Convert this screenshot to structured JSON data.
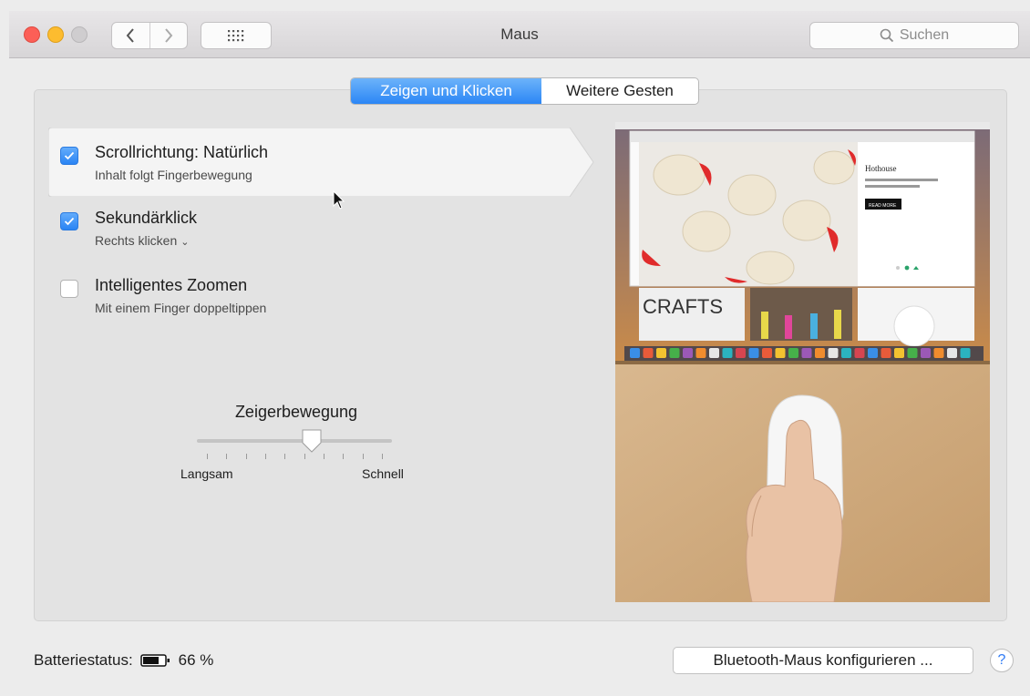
{
  "window": {
    "title": "Maus",
    "search_placeholder": "Suchen"
  },
  "tabs": [
    {
      "label": "Zeigen und Klicken",
      "active": true
    },
    {
      "label": "Weitere Gesten",
      "active": false
    }
  ],
  "options": [
    {
      "label": "Scrollrichtung: Natürlich",
      "sublabel": "Inhalt folgt Fingerbewegung",
      "checked": true,
      "selected": true
    },
    {
      "label": "Sekundärklick",
      "sublabel": "Rechts klicken",
      "checked": true,
      "has_dropdown": true
    },
    {
      "label": "Intelligentes Zoomen",
      "sublabel": "Mit einem Finger doppeltippen",
      "checked": false
    }
  ],
  "pointer_speed": {
    "title": "Zeigerbewegung",
    "min_label": "Langsam",
    "max_label": "Schnell",
    "ticks": 10,
    "value_fraction": 0.6
  },
  "preview": {
    "site_title": "Hothouse",
    "banner_text": "CRAFTS",
    "button_text": "READ MORE"
  },
  "footer": {
    "battery_label": "Batteriestatus:",
    "battery_value": "66 %",
    "configure_button": "Bluetooth-Maus konfigurieren ...",
    "help": "?"
  },
  "colors": {
    "accent": "#2b86f5",
    "close": "#fc5f57",
    "minimize": "#fdbc2f"
  }
}
